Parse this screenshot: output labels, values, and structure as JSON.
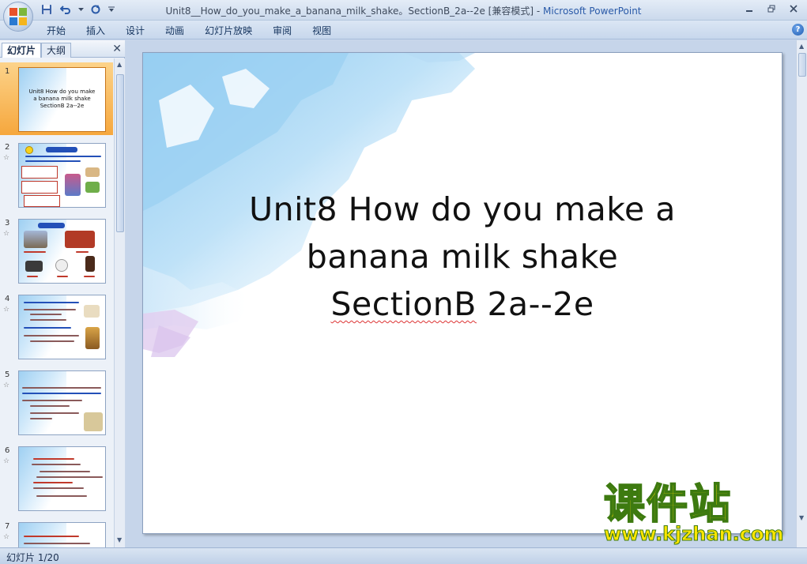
{
  "window": {
    "title": "Unit8__How_do_you_make_a_banana_milk_shake。SectionB_2a--2e [兼容模式]",
    "separator": " - ",
    "app_name": "Microsoft PowerPoint"
  },
  "ribbon": {
    "tabs": [
      "开始",
      "插入",
      "设计",
      "动画",
      "幻灯片放映",
      "审阅",
      "视图"
    ],
    "help": "?"
  },
  "left_pane": {
    "tabs": [
      "幻灯片",
      "大纲"
    ],
    "close": "✕",
    "slides": [
      {
        "number": "1",
        "text": "Unit8 How do you make a banana milk shake SectionB 2a--2e"
      },
      {
        "number": "2"
      },
      {
        "number": "3"
      },
      {
        "number": "4"
      },
      {
        "number": "5"
      },
      {
        "number": "6"
      },
      {
        "number": "7"
      }
    ],
    "star": "☆"
  },
  "slide": {
    "line1": "Unit8 How do you make a",
    "line2": "banana milk shake",
    "line3a": "SectionB",
    "line3b": " 2a--2e"
  },
  "watermark": {
    "cn": "课件站",
    "url": "www.kjzhan.com"
  },
  "status": {
    "text": "幻灯片 1/20"
  },
  "colors": {
    "accent": "#2a5aa8",
    "selected_thumb": "#f6a73d"
  }
}
